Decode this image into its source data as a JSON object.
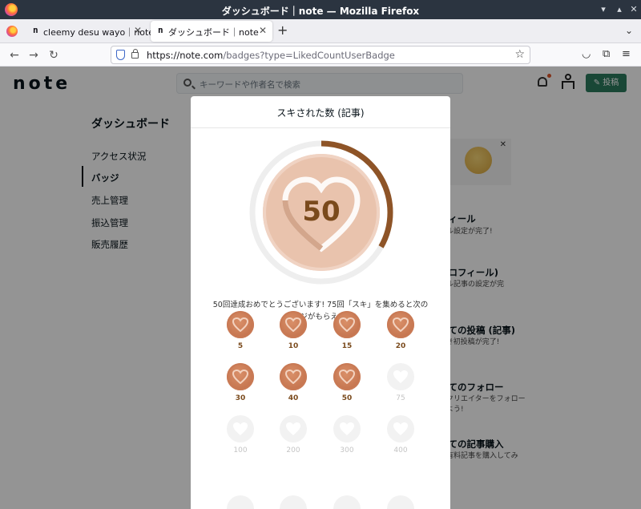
{
  "window": {
    "title": "ダッシュボード｜note — Mozilla Firefox"
  },
  "tabs": [
    {
      "label": "cleemy desu wayo｜note",
      "favicon": "n"
    },
    {
      "label": "ダッシュボード｜note",
      "favicon": "n"
    }
  ],
  "navbar": {
    "url_host": "https://note.com",
    "url_path": "/badges?type=LikedCountUserBadge"
  },
  "note_header": {
    "logo": "note",
    "search_placeholder": "キーワードや作者名で検索",
    "post_label": "投稿"
  },
  "sidebar": {
    "title": "ダッシュボード",
    "items": [
      "アクセス状況",
      "バッジ",
      "売上管理",
      "振込管理",
      "販売履歴"
    ],
    "active_index": 1
  },
  "right_list": [
    {
      "title": "フィール",
      "sub": "ール設定が完了!"
    },
    {
      "title": "プロフィール)",
      "sub": "ール記事の設定が完"
    },
    {
      "title": "めての投稿 (記事)",
      "sub": "てき初投稿が完了!"
    },
    {
      "title": "めてのフォロー",
      "sub": "るクリエイターをフォロー\nしよう!"
    },
    {
      "title": "めての記事購入",
      "sub": "の有料記事を購入してみ"
    }
  ],
  "modal": {
    "title": "スキされた数 (記事)",
    "current_value": "50",
    "progress_fraction": 0.333,
    "message_line1": "50回達成おめでとうございます! 75回「スキ」を集めると次の",
    "message_line2": "バッジがもらえます!",
    "badges": [
      {
        "label": "5",
        "earned": true
      },
      {
        "label": "10",
        "earned": true
      },
      {
        "label": "15",
        "earned": true
      },
      {
        "label": "20",
        "earned": true
      },
      {
        "label": "30",
        "earned": true
      },
      {
        "label": "40",
        "earned": true
      },
      {
        "label": "50",
        "earned": true
      },
      {
        "label": "75",
        "earned": false
      },
      {
        "label": "100",
        "earned": false
      },
      {
        "label": "200",
        "earned": false
      },
      {
        "label": "300",
        "earned": false
      },
      {
        "label": "400",
        "earned": false
      }
    ]
  },
  "colors": {
    "accent_green": "#2c7a5e",
    "progress_brown": "#8e5427",
    "badge_earned": "#c97a55",
    "badge_locked": "#f2f2f2"
  }
}
